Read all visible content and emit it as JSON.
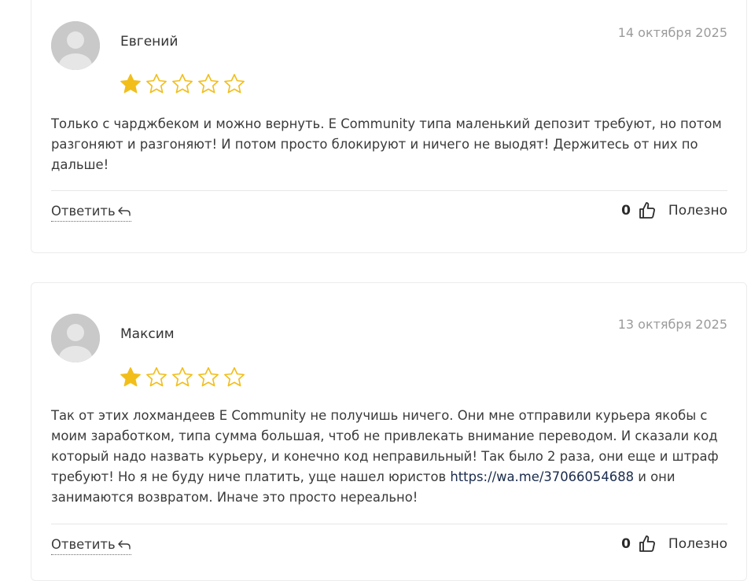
{
  "colors": {
    "star": "#f2be1a",
    "text": "#3a3a3a",
    "muted": "#9b9b9b"
  },
  "reviews": [
    {
      "author": "Евгений",
      "date": "14 октября 2025",
      "rating": 1,
      "max_rating": 5,
      "text": "Только с чарджбеком и можно вернуть. E Community типа маленький депозит требуют, но потом разгоняют и разгоняют! И потом просто блокируют и ничего не выодят! Держитесь от них по дальше!",
      "reply_label": "Ответить",
      "helpful_count": "0",
      "helpful_label": "Полезно"
    },
    {
      "author": "Максим",
      "date": "13 октября 2025",
      "rating": 1,
      "max_rating": 5,
      "text_before_link": "Так от этих лохмандеев E Community не получишь ничего. Они мне отправили курьера якобы с моим заработком, типа сумма большая, чтоб не привлекать внимание переводом. И сказали код который надо назвать курьеру, и конечно код неправильный! Так было 2 раза, они еще и штраф требуют! Но я не буду ниче платить, уще нашел юристов ",
      "link_text": "https://wa.me/37066054688",
      "text_after_link": " и они занимаются возвратом. Иначе это просто нереально!",
      "reply_label": "Ответить",
      "helpful_count": "0",
      "helpful_label": "Полезно"
    }
  ]
}
